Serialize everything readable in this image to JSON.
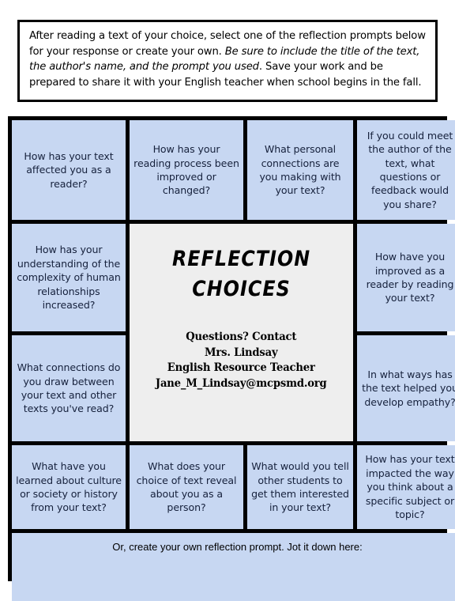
{
  "instruction": {
    "part1": "After reading a text of your choice, select one of the reflection prompts below for your response or create your own. ",
    "emphasis": "Be sure to include the title of the text, the author's name, and the prompt you used",
    "part2": ". Save your work and be prepared to share it with your English teacher when school begins in the fall."
  },
  "center": {
    "title_line1": "REFLECTION",
    "title_line2": "CHOICES",
    "contact_line1": "Questions? Contact",
    "contact_line2": "Mrs. Lindsay",
    "contact_line3": "English Resource Teacher",
    "contact_line4": "Jane_M_Lindsay@mcpsmd.org"
  },
  "prompts": {
    "r1c1": "How has your text affected you as a reader?",
    "r1c2": "How has your reading process been improved or changed?",
    "r1c3": "What personal connections are you making with your text?",
    "r1c4": "If you could meet the author of the text, what questions or feedback would you share?",
    "r2c1": "How has your understanding of the complexity of human relationships increased?",
    "r2c4": "How have you improved as a reader by reading your text?",
    "r3c1": "What connections do you draw between your text and other texts you've read?",
    "r3c4": "In what ways has the text helped you develop empathy?",
    "r4c1": "What have you learned about culture or society or history from your text?",
    "r4c2": "What does your choice of text reveal about you as a person?",
    "r4c3": "What would you tell other students to get them interested in your text?",
    "r4c4": "How has your text impacted the way you think about a specific subject or topic?",
    "bottom": "Or, create your own reflection prompt. Jot it down here:"
  },
  "colors": {
    "cell_fill": "#c7d7f2",
    "center_fill": "#eeeeee",
    "border": "#000000",
    "text": "#16213c"
  }
}
